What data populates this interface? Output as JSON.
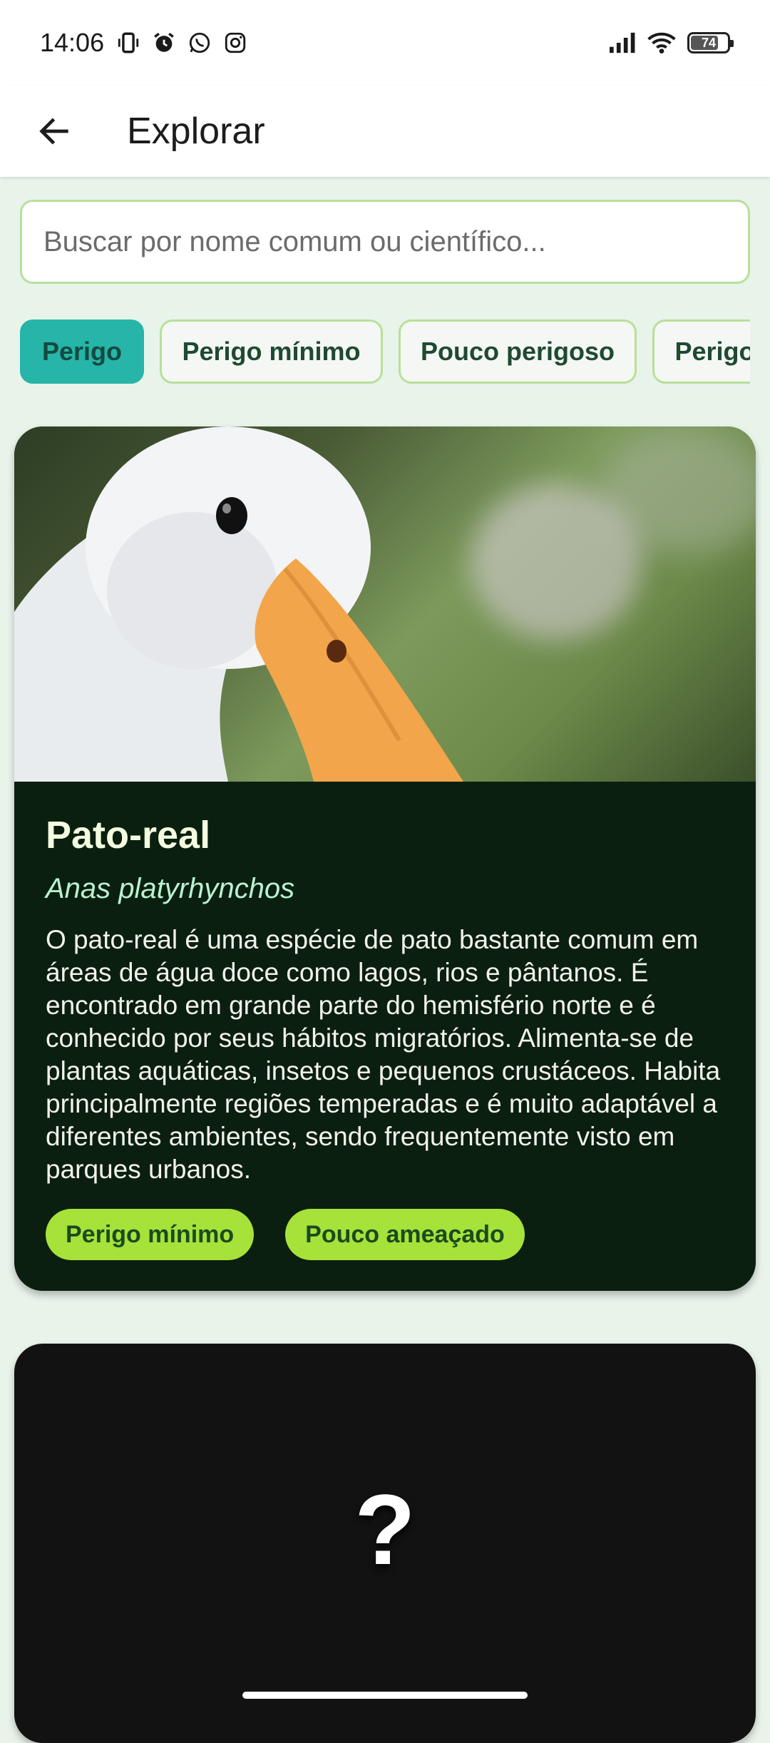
{
  "status": {
    "time": "14:06",
    "battery": "74",
    "icons": [
      "vibrate-icon",
      "alarm-icon",
      "whatsapp-icon",
      "instagram-icon",
      "signal-icon",
      "wifi-icon",
      "battery-icon"
    ]
  },
  "appbar": {
    "title": "Explorar",
    "back_icon": "back-arrow-icon"
  },
  "search": {
    "placeholder": "Buscar por nome comum ou científico...",
    "value": ""
  },
  "filters": {
    "chips": [
      {
        "label": "Perigo",
        "active": true
      },
      {
        "label": "Perigo mínimo",
        "active": false
      },
      {
        "label": "Pouco perigoso",
        "active": false
      },
      {
        "label": "Perigo",
        "active": false
      }
    ]
  },
  "cards": [
    {
      "title": "Pato-real",
      "scientific_name": "Anas platyrhynchos",
      "description": "O pato-real é uma espécie de pato bastante comum em áreas de água doce como lagos, rios e pântanos. É encontrado em grande parte do hemisfério norte e é conhecido por seus hábitos migratórios. Alimenta-se de plantas aquáticas, insetos e pequenos crustáceos. Habita principalmente regiões temperadas e é muito adaptável a diferentes ambientes, sendo frequentemente visto em parques urbanos.",
      "badges": [
        "Perigo mínimo",
        "Pouco ameaçado"
      ],
      "image": "white-duck-photo"
    },
    {
      "placeholder_symbol": "?"
    }
  ],
  "colors": {
    "background": "#e8f3ea",
    "chip_active": "#26b5a8",
    "chip_border": "#b7e09a",
    "card_background": "#0b1f10",
    "badge": "#a6e23a"
  }
}
